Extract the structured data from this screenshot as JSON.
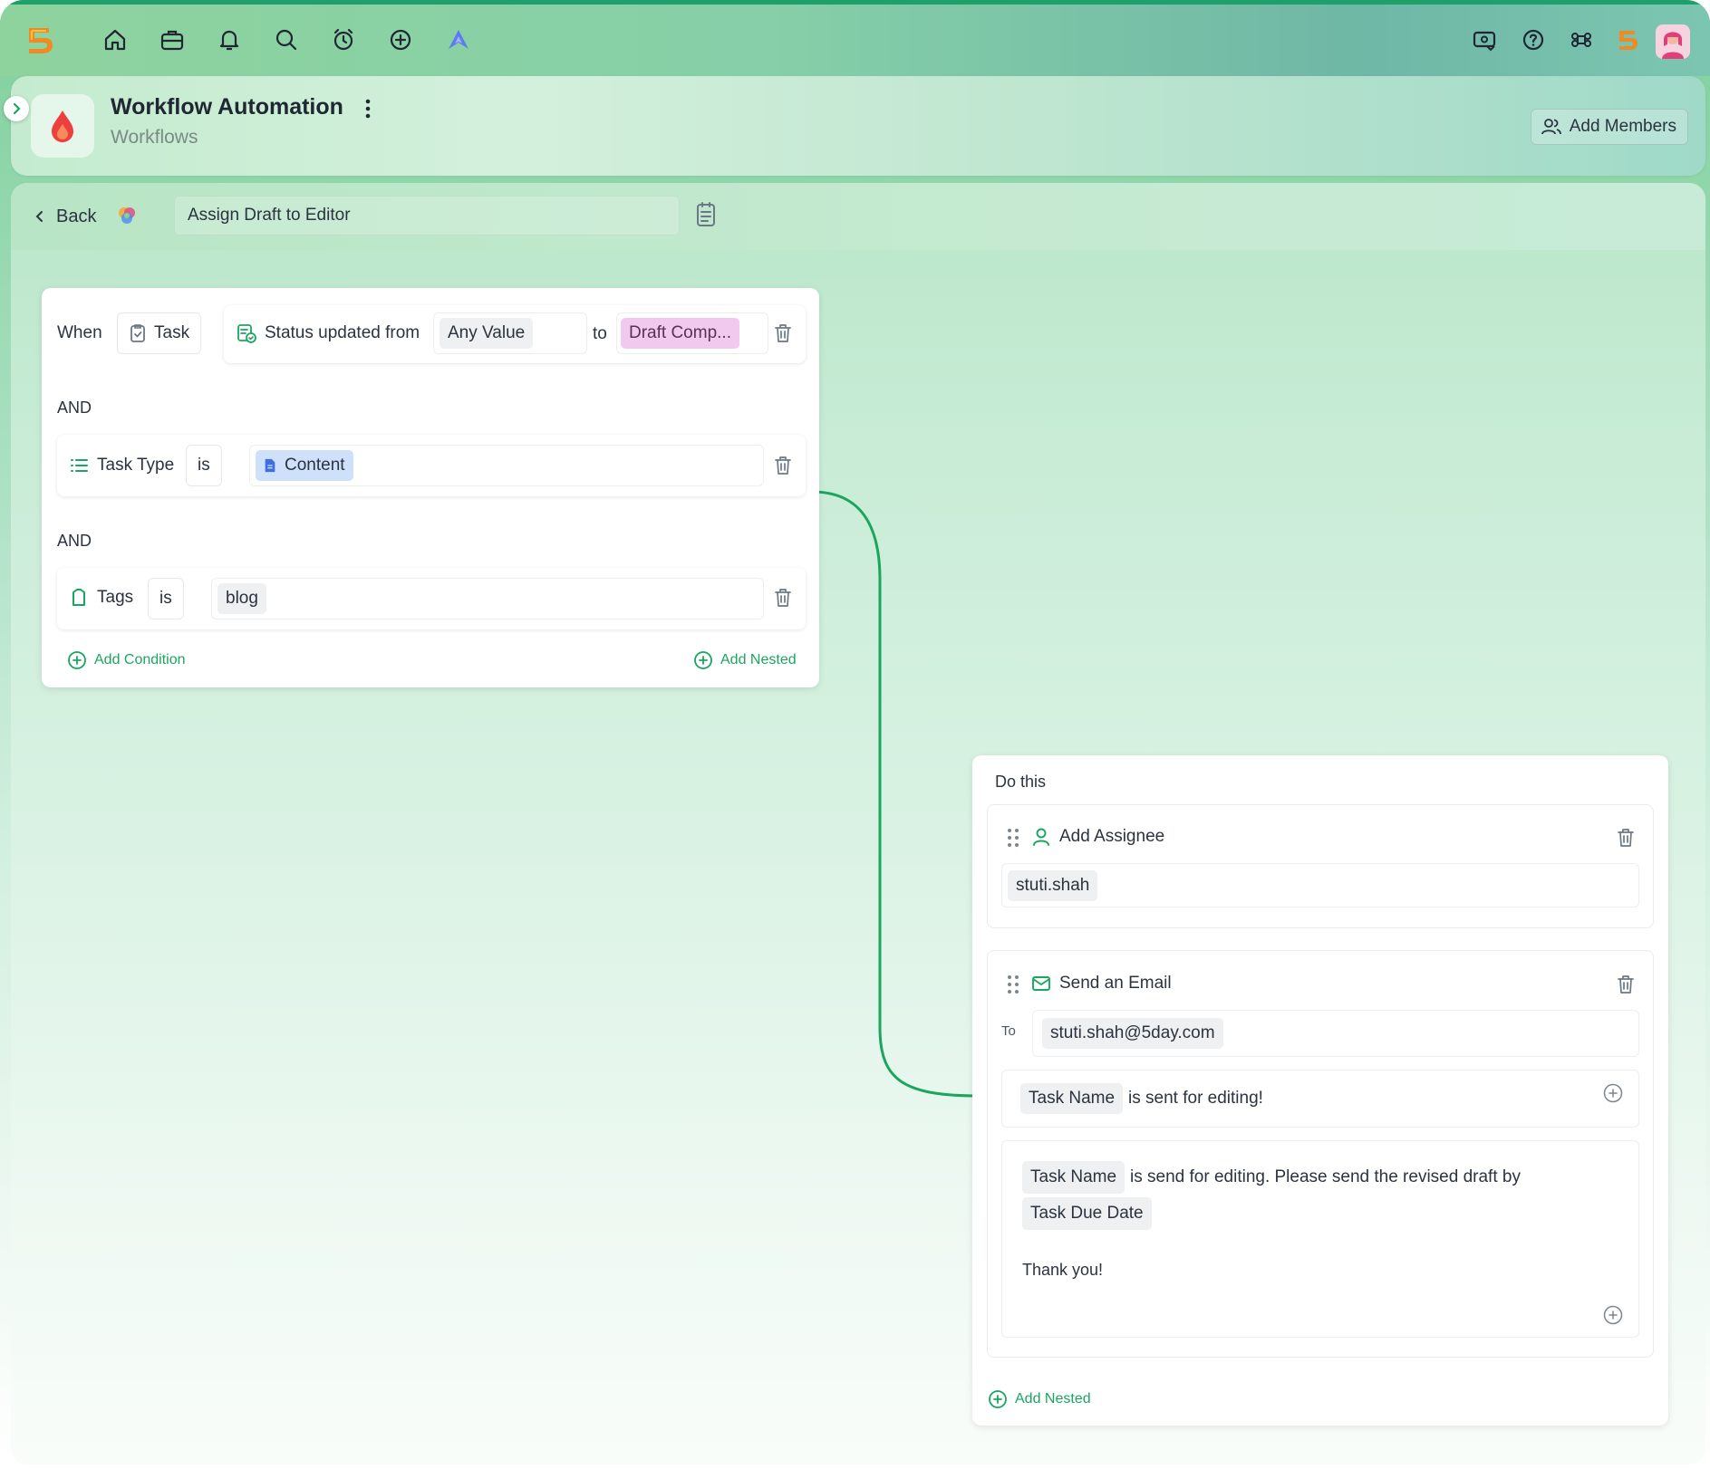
{
  "header": {
    "title": "Workflow Automation",
    "subtitle": "Workflows",
    "add_members_label": "Add Members"
  },
  "nav": {
    "icons": [
      "home-icon",
      "briefcase-icon",
      "bell-icon",
      "search-icon",
      "alarm-clock-icon",
      "plus-circle-icon",
      "ai-assistant-icon"
    ],
    "right_icons": [
      "billing-icon",
      "help-icon",
      "command-icon",
      "brand-logo-icon",
      "user-avatar"
    ]
  },
  "toolbar": {
    "back_label": "Back",
    "workflow_name": "Assign Draft to Editor"
  },
  "trigger": {
    "when_label": "When",
    "entity": "Task",
    "event_label": "Status updated from",
    "from_value": "Any Value",
    "to_label": "to",
    "to_value": "Draft Comp...",
    "conditions": [
      {
        "connector": "AND",
        "field": "Task Type",
        "operator": "is",
        "value": "Content"
      },
      {
        "connector": "AND",
        "field": "Tags",
        "operator": "is",
        "value": "blog"
      }
    ],
    "add_condition_label": "Add Condition",
    "add_nested_label": "Add Nested"
  },
  "actions": {
    "section_label": "Do this",
    "add_assignee": {
      "title": "Add Assignee",
      "value": "stuti.shah"
    },
    "send_email": {
      "title": "Send an Email",
      "to_label": "To",
      "to_value": "stuti.shah@5day.com",
      "subject_token": "Task Name",
      "subject_text": "is sent for editing!",
      "body_token_1": "Task Name",
      "body_text_1": "is send for editing. Please send the revised draft by",
      "body_token_2": "Task Due Date",
      "body_closing": "Thank you!"
    },
    "add_nested_label": "Add Nested"
  },
  "colors": {
    "accent_green": "#1aa65f",
    "to_value_bg": "#f1c9ee",
    "content_chip_bg": "#cfe0fb"
  }
}
